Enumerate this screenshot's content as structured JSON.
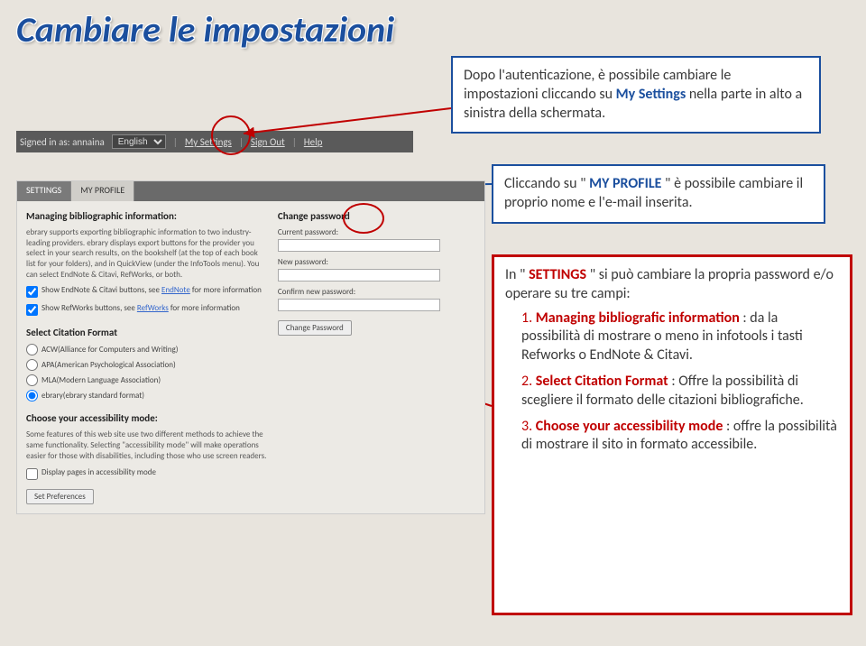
{
  "title": "Cambiare le impostazioni",
  "callout1": {
    "t1": "Dopo l'autenticazione, è possibile cambiare le impostazioni cliccando su ",
    "b1": "My Settings ",
    "t2": "nella parte in alto a sinistra della schermata."
  },
  "callout2": {
    "t1": "Cliccando su \"",
    "b1": "MY PROFILE",
    "t2": "\" è possibile cambiare il proprio nome e l'e-mail inserita."
  },
  "callout3": {
    "t1": "In \"",
    "b1": "SETTINGS",
    "t2": "\" si può cambiare la propria password e/o operare su tre campi:",
    "i1h": "Managing bibliografic information",
    "i1": ": da la possibilità di mostrare o meno in infotools i tasti Refworks o EndNote & Citavi.",
    "i2h": "Select Citation Format",
    "i2": ": Offre la possibilità di scegliere il formato delle citazioni bibliografiche.",
    "i3h": "Choose your accessibility mode",
    "i3": ": offre la possibilità di mostrare il sito in formato accessibile."
  },
  "topbar": {
    "signed": "Signed in as: annaina",
    "lang": "English",
    "mysettings": "My Settings",
    "signout": "Sign Out",
    "help": "Help"
  },
  "tabs": {
    "settings": "SETTINGS",
    "profile": "MY PROFILE"
  },
  "left": {
    "h1": "Managing bibliographic information:",
    "desc": "ebrary supports exporting bibliographic information to two industry-leading providers. ebrary displays export buttons for the provider you select in your search results, on the bookshelf (at the top of each book list for your folders), and in QuickView (under the InfoTools menu). You can select EndNote & Citavi, RefWorks, or both.",
    "chk1a": "Show EndNote & Citavi buttons, see ",
    "chk1link": "EndNote",
    "chk1b": " for more information",
    "chk2a": "Show RefWorks buttons, see ",
    "chk2link": "RefWorks",
    "chk2b": " for more information",
    "h2": "Select Citation Format",
    "r1": "ACW(Alliance for Computers and Writing)",
    "r2": "APA(American Psychological Association)",
    "r3": "MLA(Modern Language Association)",
    "r4": "ebrary(ebrary standard format)",
    "h3": "Choose your accessibility mode:",
    "desc2": "Some features of this web site use two different methods to achieve the same functionality. Selecting \"accessibility mode\" will make operations easier for those with disabilities, including those who use screen readers.",
    "chk3": "Display pages in accessibility mode",
    "btn": "Set Preferences"
  },
  "right": {
    "h": "Change password",
    "l1": "Current password:",
    "l2": "New password:",
    "l3": "Confirm new password:",
    "btn": "Change Password"
  }
}
